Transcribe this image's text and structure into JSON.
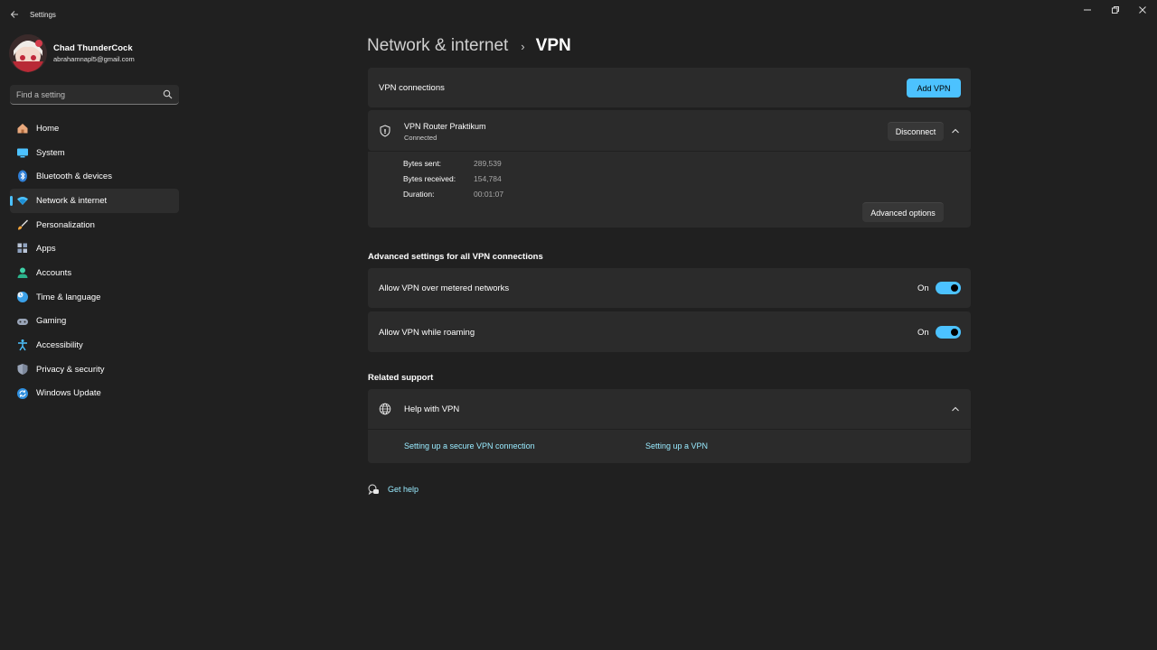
{
  "window": {
    "app_title": "Settings"
  },
  "profile": {
    "name": "Chad ThunderCock",
    "email": "abrahamnapl5@gmail.com"
  },
  "search": {
    "placeholder": "Find a setting"
  },
  "sidebar": {
    "items": [
      {
        "label": "Home",
        "icon": "home-icon"
      },
      {
        "label": "System",
        "icon": "system-icon"
      },
      {
        "label": "Bluetooth & devices",
        "icon": "bluetooth-icon"
      },
      {
        "label": "Network & internet",
        "icon": "network-icon",
        "active": true
      },
      {
        "label": "Personalization",
        "icon": "brush-icon"
      },
      {
        "label": "Apps",
        "icon": "apps-icon"
      },
      {
        "label": "Accounts",
        "icon": "accounts-icon"
      },
      {
        "label": "Time & language",
        "icon": "globe-clock-icon"
      },
      {
        "label": "Gaming",
        "icon": "gamepad-icon"
      },
      {
        "label": "Accessibility",
        "icon": "accessibility-icon"
      },
      {
        "label": "Privacy & security",
        "icon": "shield-icon"
      },
      {
        "label": "Windows Update",
        "icon": "update-icon"
      }
    ]
  },
  "breadcrumb": {
    "parent": "Network & internet",
    "separator": "›",
    "current": "VPN"
  },
  "vpn": {
    "connections_label": "VPN connections",
    "add_button": "Add VPN",
    "connection": {
      "name": "VPN Router Praktikum",
      "status": "Connected",
      "disconnect_button": "Disconnect",
      "stats": [
        {
          "label": "Bytes sent:",
          "value": "289,539"
        },
        {
          "label": "Bytes received:",
          "value": "154,784"
        },
        {
          "label": "Duration:",
          "value": "00:01:07"
        }
      ],
      "advanced_button": "Advanced options"
    }
  },
  "advanced": {
    "title": "Advanced settings for all VPN connections",
    "settings": [
      {
        "label": "Allow VPN over metered networks",
        "state": "On",
        "on": true
      },
      {
        "label": "Allow VPN while roaming",
        "state": "On",
        "on": true
      }
    ]
  },
  "related": {
    "title": "Related support",
    "help_title": "Help with VPN",
    "links": [
      "Setting up a secure VPN connection",
      "Setting up a VPN"
    ]
  },
  "get_help": "Get help",
  "colors": {
    "accent": "#4cc2ff",
    "background": "#202020",
    "card": "#2b2b2b",
    "link": "#99ebff"
  }
}
